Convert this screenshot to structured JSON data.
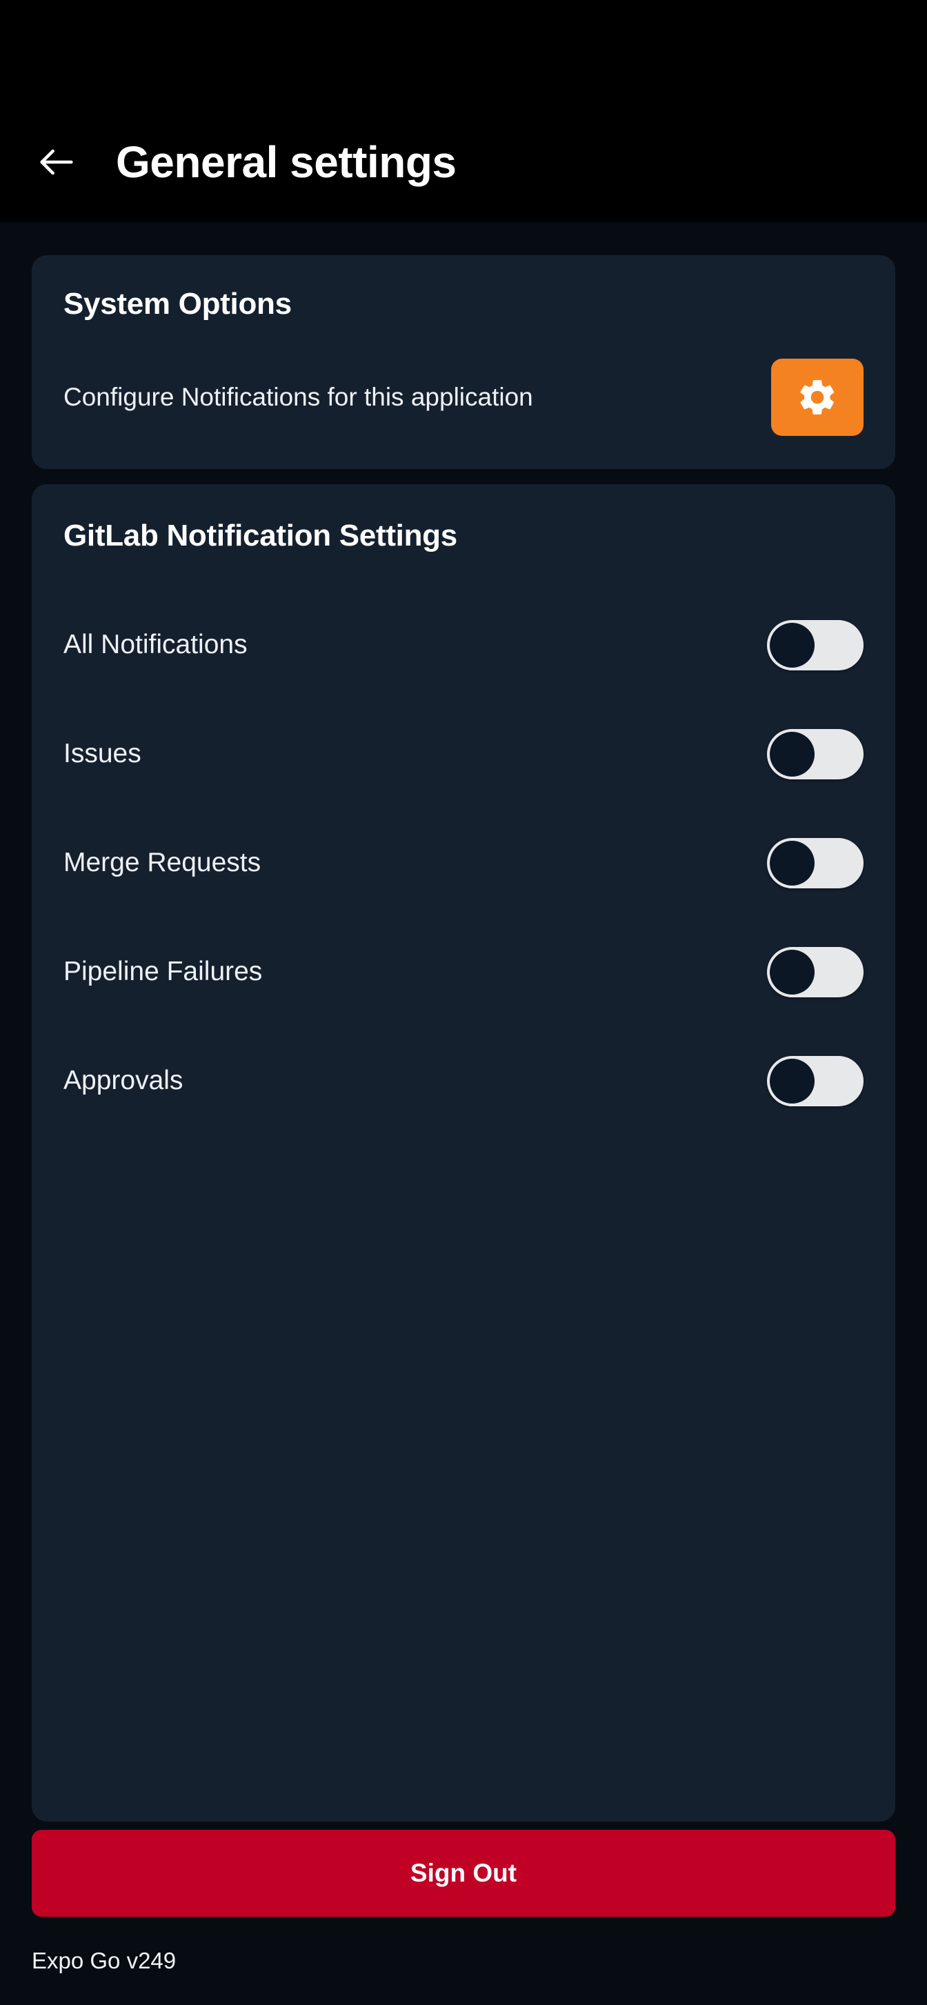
{
  "header": {
    "title": "General settings",
    "back_icon": "arrow-left-icon"
  },
  "system_options": {
    "title": "System Options",
    "row_label": "Configure Notifications for this application",
    "gear_icon": "gear-icon",
    "gear_button_color": "#f58220"
  },
  "gitlab_notifications": {
    "title": "GitLab Notification Settings",
    "items": [
      {
        "label": "All Notifications",
        "enabled": false
      },
      {
        "label": "Issues",
        "enabled": false
      },
      {
        "label": "Merge Requests",
        "enabled": false
      },
      {
        "label": "Pipeline Failures",
        "enabled": false
      },
      {
        "label": "Approvals",
        "enabled": false
      }
    ]
  },
  "signout": {
    "label": "Sign Out",
    "color": "#c10025"
  },
  "footer": {
    "version_text": "Expo Go v249"
  },
  "theme": {
    "page_background": "#070c13",
    "header_background": "#000000",
    "card_background": "#15202f",
    "text_primary": "#ffffff",
    "text_secondary": "#eef2f7",
    "toggle_track": "#e7e8ea",
    "toggle_knob": "#0c1726"
  }
}
